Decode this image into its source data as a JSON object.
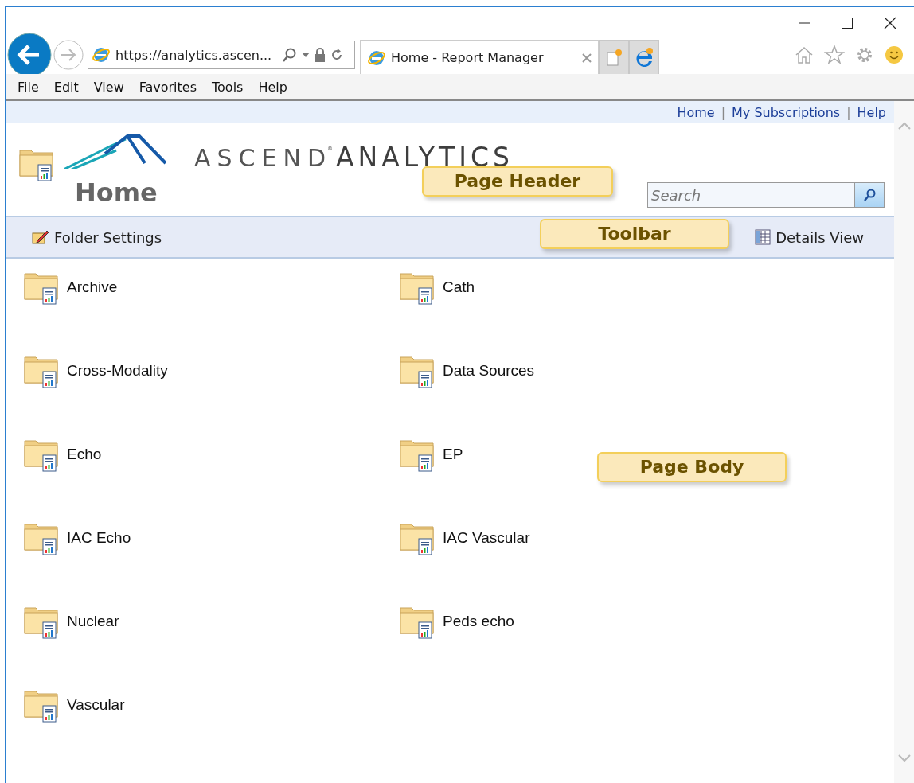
{
  "browser": {
    "address": "https://analytics.ascen...",
    "tab": {
      "title": "Home - Report Manager",
      "selected": true
    },
    "menu": [
      "File",
      "Edit",
      "View",
      "Favorites",
      "Tools",
      "Help"
    ]
  },
  "page": {
    "links": [
      "Home",
      "My Subscriptions",
      "Help"
    ],
    "link_separator": "|",
    "logo": {
      "word_1": "ASCEND",
      "mark": "®",
      "word_2": "ANALYTICS"
    },
    "title": "Home",
    "search": {
      "placeholder": "Search"
    },
    "toolbar": [
      {
        "kind": "settings",
        "label": "Folder Settings"
      },
      {
        "kind": "details",
        "label": "Details View"
      }
    ],
    "folders": [
      {
        "name": "Archive"
      },
      {
        "name": "Cath"
      },
      {
        "name": "Cross-Modality"
      },
      {
        "name": "Data Sources"
      },
      {
        "name": "Echo"
      },
      {
        "name": "EP"
      },
      {
        "name": "IAC Echo"
      },
      {
        "name": "IAC Vascular"
      },
      {
        "name": "Nuclear"
      },
      {
        "name": "Peds echo"
      },
      {
        "name": "Vascular"
      }
    ]
  },
  "callouts": [
    {
      "kind": "header",
      "text": "Page Header"
    },
    {
      "kind": "toolbar",
      "text": "Toolbar"
    },
    {
      "kind": "body",
      "text": "Page Body"
    }
  ]
}
